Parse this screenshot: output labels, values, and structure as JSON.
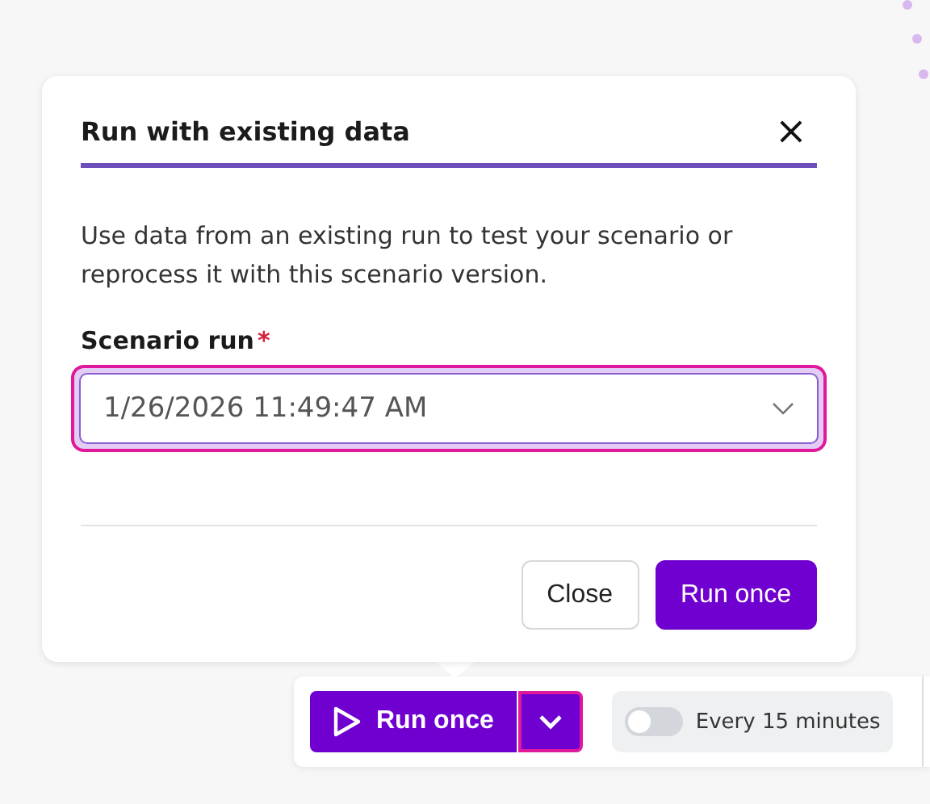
{
  "dialog": {
    "title": "Run with existing data",
    "close_icon": "×",
    "description": "Use data from an existing run to test your scenario or reprocess it with this scenario version.",
    "field": {
      "label": "Scenario run",
      "required_mark": "*",
      "value": "1/26/2026 11:49:47 AM",
      "focused": true
    },
    "buttons": [
      {
        "label": "Close",
        "kind": "secondary"
      },
      {
        "label": "Run once",
        "kind": "primary"
      }
    ]
  },
  "toolbar": {
    "run_button": {
      "label": "Run once",
      "menu_focused": true
    },
    "schedule": {
      "label": "Every 15 minutes",
      "on": false
    }
  }
}
